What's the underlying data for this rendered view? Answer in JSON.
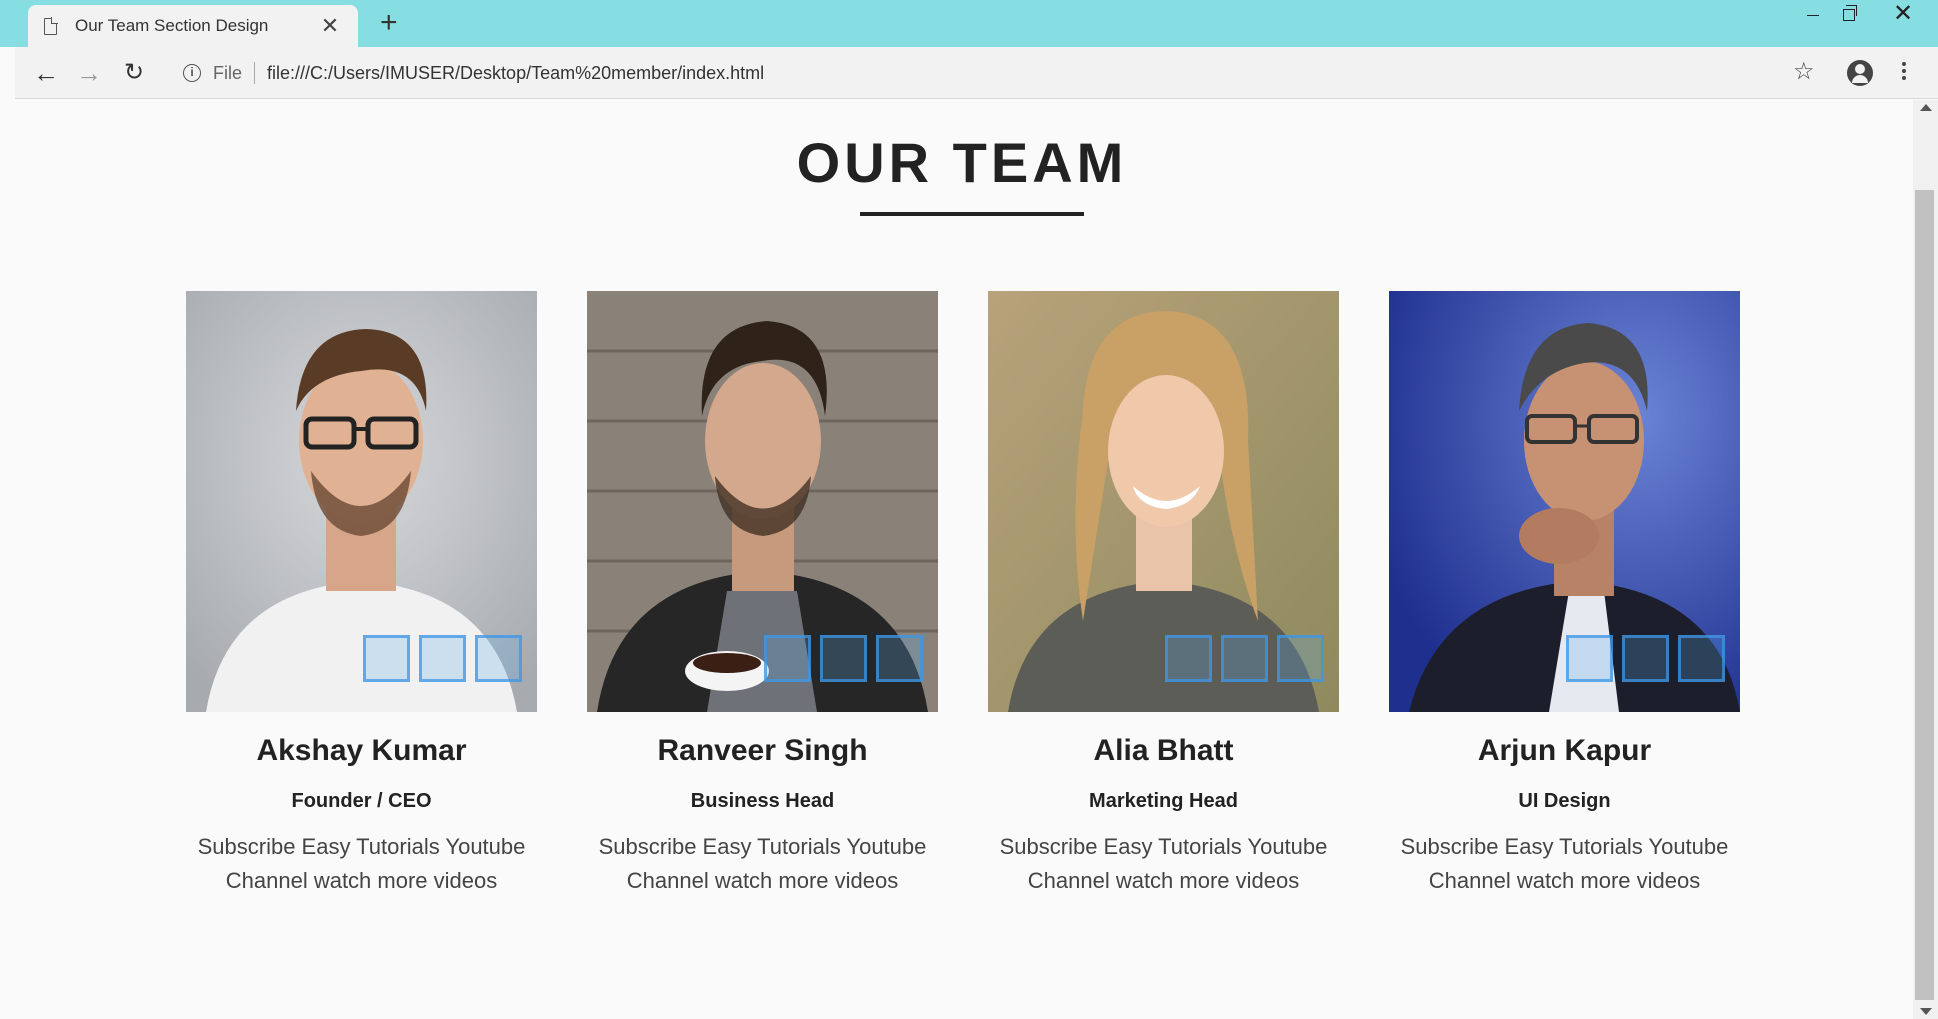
{
  "browser": {
    "tab_title": "Our Team Section Design",
    "tab_close": "✕",
    "new_tab": "+",
    "url_scheme": "File",
    "url": "file:///C:/Users/IMUSER/Desktop/Team%20member/index.html"
  },
  "page": {
    "heading": "OUR TEAM"
  },
  "members": [
    {
      "name": "Akshay Kumar",
      "role": "Founder / CEO",
      "desc": "Subscribe Easy Tutorials Youtube Channel watch more videos"
    },
    {
      "name": "Ranveer Singh",
      "role": "Business Head",
      "desc": "Subscribe Easy Tutorials Youtube Channel watch more videos"
    },
    {
      "name": "Alia Bhatt",
      "role": "Marketing Head",
      "desc": "Subscribe Easy Tutorials Youtube Channel watch more videos"
    },
    {
      "name": "Arjun Kapur",
      "role": "UI Design",
      "desc": "Subscribe Easy Tutorials Youtube Channel watch more videos"
    }
  ],
  "colors": {
    "titlebar": "#86dee2",
    "social_overlay": "#3c96e6"
  }
}
